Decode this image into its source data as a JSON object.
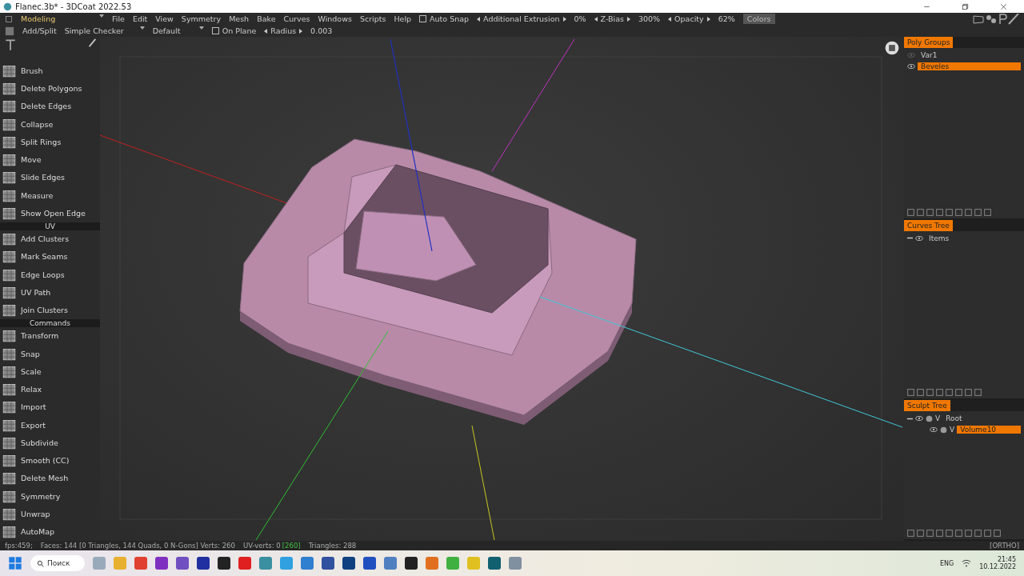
{
  "window": {
    "title": "Flanec.3b* - 3DCoat 2022.53"
  },
  "menu_bar": {
    "mode": "Modeling",
    "menus": [
      "File",
      "Edit",
      "View",
      "Symmetry",
      "Mesh",
      "Bake",
      "Curves",
      "Windows",
      "Scripts",
      "Help"
    ],
    "auto_snap": {
      "label": "Auto Snap",
      "checked": false
    },
    "params": [
      {
        "label": "Additional Extrusion",
        "value": "0%"
      },
      {
        "label": "Z-Bias",
        "value": "300%"
      },
      {
        "label": "Opacity",
        "value": "62%"
      }
    ],
    "colors_button": "Colors"
  },
  "tool_bar": {
    "tool": "Add/Split",
    "dropdowns": [
      "Simple Checker",
      "Default"
    ],
    "on_plane": {
      "label": "On Plane",
      "checked": false
    },
    "radius": {
      "label": "Radius",
      "value": "0.003"
    }
  },
  "tool_groups": [
    {
      "items": [
        "Brush",
        "Delete Polygons",
        "Delete Edges",
        "Collapse",
        "Split Rings",
        "Move",
        "Slide Edges",
        "Measure",
        "Show Open Edge"
      ]
    },
    {
      "title": "UV",
      "items": [
        "Add Clusters",
        "Mark Seams",
        "Edge Loops",
        "UV Path",
        "Join Clusters"
      ]
    },
    {
      "title": "Commands",
      "items": [
        "Transform",
        "Snap",
        "Scale",
        "Relax",
        "Import",
        "Export",
        "Subdivide",
        "Smooth (CC)",
        "Delete Mesh",
        "Symmetry",
        "Unwrap",
        "AutoMap"
      ]
    }
  ],
  "poly_groups": {
    "title": "Poly Groups",
    "items": [
      {
        "label": "Var1",
        "selected": false,
        "visible": false
      },
      {
        "label": "Beveles",
        "selected": true,
        "visible": true
      }
    ]
  },
  "curves_tree": {
    "title": "Curves Tree",
    "items": [
      {
        "label": "Items",
        "expanded": true
      }
    ]
  },
  "sculpt_tree": {
    "title": "Sculpt Tree",
    "items": [
      {
        "label": "Root",
        "flag": "V",
        "selected": false,
        "expanded": true,
        "children": [
          {
            "label": "Volume10",
            "flag": "V",
            "selected": true
          }
        ]
      }
    ]
  },
  "status_bar": {
    "segments": [
      {
        "text": "fps:459;",
        "kind": "plain"
      },
      {
        "text": "Faces: 144 [0 Triangles, 144 Quads, 0 N-Gons] Verts: 260",
        "kind": "plain"
      },
      {
        "text": "UV-verts: 0",
        "kind": "plain"
      },
      {
        "text": "[260]",
        "kind": "highlight"
      },
      {
        "text": "Triangles: 288",
        "kind": "plain"
      }
    ],
    "view_mode": "[ORTHO]"
  },
  "taskbar": {
    "search": "Поиск",
    "language": "ENG",
    "time": "21:45",
    "date": "10.12.2022"
  }
}
